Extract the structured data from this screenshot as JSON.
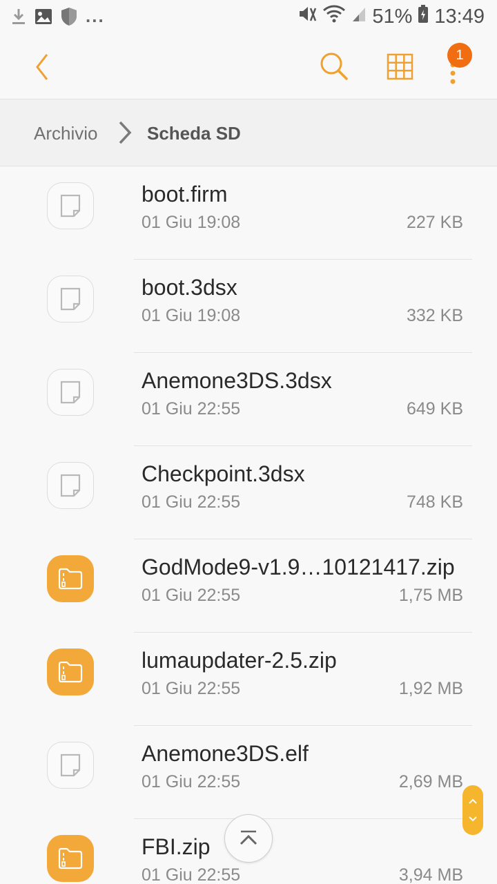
{
  "status_bar": {
    "battery": "51%",
    "time": "13:49",
    "overflow": "...",
    "icons": [
      "download-icon",
      "image-icon",
      "shield-icon",
      "mute-icon",
      "wifi-icon",
      "signal-icon",
      "battery-icon"
    ]
  },
  "toolbar": {
    "back_icon": "chevron-left-icon",
    "search_icon": "search-icon",
    "grid_icon": "grid-view-icon",
    "more_icon": "more-vert-icon",
    "badge_count": "1",
    "accent_color": "#f0a030",
    "badge_color": "#f06d12"
  },
  "breadcrumb": {
    "items": [
      "Archivio",
      "Scheda SD"
    ]
  },
  "files": [
    {
      "name": "boot.firm",
      "date": "01 Giu 19:08",
      "size": "227 KB",
      "type": "file"
    },
    {
      "name": "boot.3dsx",
      "date": "01 Giu 19:08",
      "size": "332 KB",
      "type": "file"
    },
    {
      "name": "Anemone3DS.3dsx",
      "date": "01 Giu 22:55",
      "size": "649 KB",
      "type": "file"
    },
    {
      "name": "Checkpoint.3dsx",
      "date": "01 Giu 22:55",
      "size": "748 KB",
      "type": "file"
    },
    {
      "name": "GodMode9-v1.9…10121417.zip",
      "date": "01 Giu 22:55",
      "size": "1,75 MB",
      "type": "zip"
    },
    {
      "name": "lumaupdater-2.5.zip",
      "date": "01 Giu 22:55",
      "size": "1,92 MB",
      "type": "zip"
    },
    {
      "name": "Anemone3DS.elf",
      "date": "01 Giu 22:55",
      "size": "2,69 MB",
      "type": "file"
    },
    {
      "name": "FBI.zip",
      "date": "01 Giu 22:55",
      "size": "3,94 MB",
      "type": "zip"
    }
  ],
  "floating": {
    "scroll_top_icon": "scroll-to-top-icon",
    "fast_scroll_icon": "fast-scroll-icon"
  }
}
